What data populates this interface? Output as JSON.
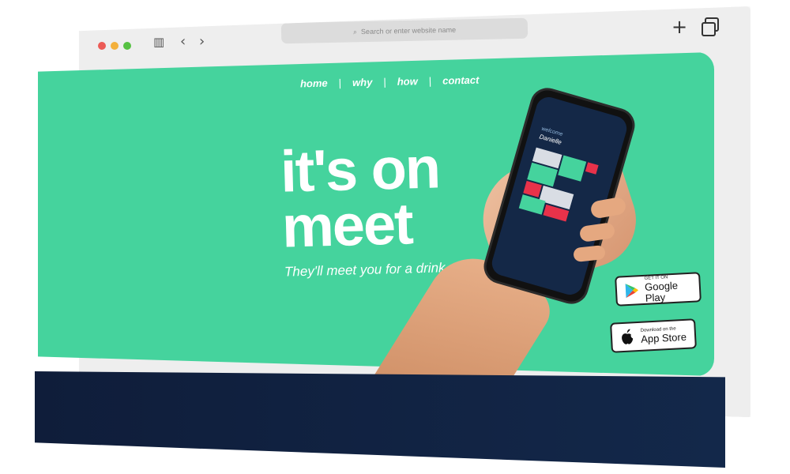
{
  "browser": {
    "address_bar": {
      "placeholder": "Search or enter website name"
    },
    "icons": {
      "sidebar": "sidebar-icon",
      "back": "chevron-left-icon",
      "forward": "chevron-right-icon",
      "new_tab": "plus-icon",
      "tabs": "tabs-icon"
    }
  },
  "nav": {
    "items": [
      {
        "label": "home"
      },
      {
        "label": "why"
      },
      {
        "label": "how"
      },
      {
        "label": "contact"
      }
    ],
    "separator": "|"
  },
  "hero": {
    "headline_line1": "it's on",
    "headline_line2": "meet",
    "tagline": "They'll meet you for a drink"
  },
  "phone": {
    "welcome": "welcome",
    "name": "Danielle"
  },
  "badges": {
    "google_play": {
      "small": "GET IT ON",
      "big": "Google Play"
    },
    "app_store": {
      "small": "Download on the",
      "big": "App Store"
    }
  },
  "colors": {
    "hero_green": "#45d39d",
    "footer_navy": "#13284a",
    "accent_red": "#e8324a",
    "text_white": "#ffffff"
  }
}
